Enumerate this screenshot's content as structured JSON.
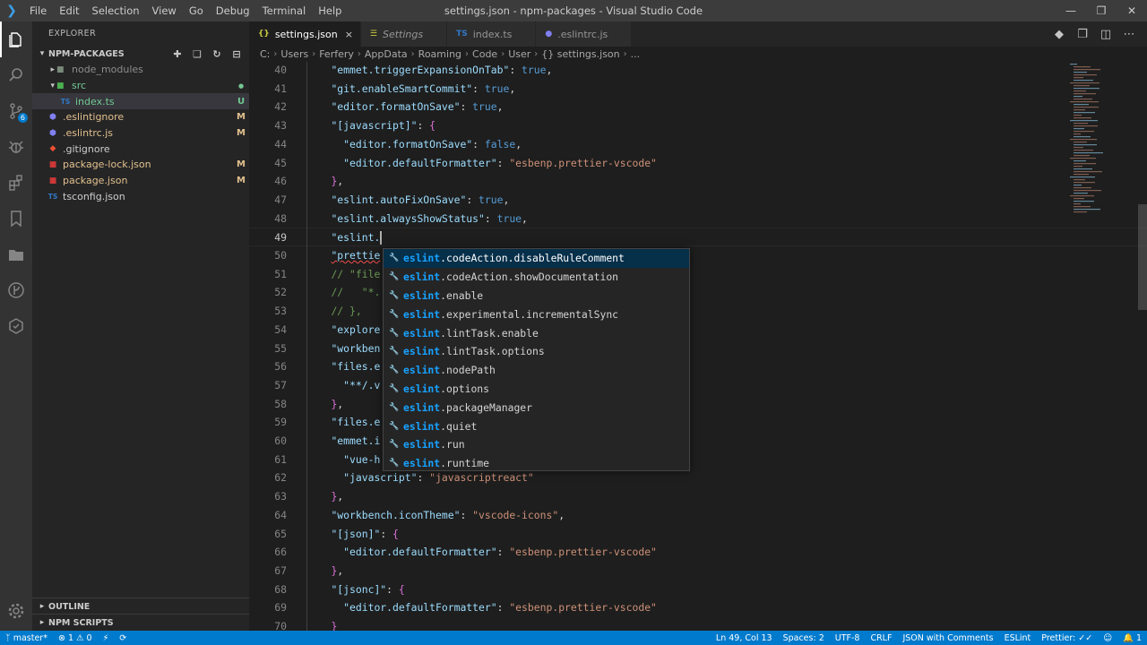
{
  "window": {
    "title": "settings.json - npm-packages - Visual Studio Code",
    "menu": [
      "File",
      "Edit",
      "Selection",
      "View",
      "Go",
      "Debug",
      "Terminal",
      "Help"
    ]
  },
  "activity": {
    "scm_badge": "6"
  },
  "sidebar": {
    "header": "EXPLORER",
    "project": "NPM-PACKAGES",
    "tree": [
      {
        "label": "node_modules",
        "indent": 1,
        "kind": "folder-collapsed",
        "status": "",
        "color": "gray"
      },
      {
        "label": "src",
        "indent": 1,
        "kind": "folder-open",
        "status": "",
        "color": "green"
      },
      {
        "label": "index.ts",
        "indent": 2,
        "kind": "ts",
        "status": "U",
        "color": "green"
      },
      {
        "label": ".eslintignore",
        "indent": 1,
        "kind": "eslint",
        "status": "M",
        "color": "yellow"
      },
      {
        "label": ".eslintrc.js",
        "indent": 1,
        "kind": "eslint",
        "status": "M",
        "color": "yellow"
      },
      {
        "label": ".gitignore",
        "indent": 1,
        "kind": "git",
        "status": "",
        "color": "plain"
      },
      {
        "label": "package-lock.json",
        "indent": 1,
        "kind": "npm",
        "status": "M",
        "color": "yellow"
      },
      {
        "label": "package.json",
        "indent": 1,
        "kind": "npm",
        "status": "M",
        "color": "yellow"
      },
      {
        "label": "tsconfig.json",
        "indent": 1,
        "kind": "ts",
        "status": "",
        "color": "plain"
      }
    ],
    "outline": "OUTLINE",
    "npm_scripts": "NPM SCRIPTS"
  },
  "tabs": [
    {
      "label": "settings.json",
      "icon": "{}",
      "active": true,
      "italic": false,
      "close": "×"
    },
    {
      "label": "Settings",
      "icon": "☰",
      "active": false,
      "italic": true,
      "close": ""
    },
    {
      "label": "index.ts",
      "icon": "TS",
      "active": false,
      "italic": false,
      "close": ""
    },
    {
      "label": ".eslintrc.js",
      "icon": "●",
      "active": false,
      "italic": false,
      "close": ""
    }
  ],
  "breadcrumb": [
    "C:",
    "Users",
    "Ferfery",
    "AppData",
    "Roaming",
    "Code",
    "User",
    "{} settings.json",
    "..."
  ],
  "editor": {
    "first_line": 40,
    "current_line": 49,
    "lines": [
      [
        [
          "    ",
          "p"
        ],
        [
          "\"emmet.triggerExpansionOnTab\"",
          "k"
        ],
        [
          ": ",
          "p"
        ],
        [
          "true",
          "b"
        ],
        [
          ",",
          "p"
        ]
      ],
      [
        [
          "    ",
          "p"
        ],
        [
          "\"git.enableSmartCommit\"",
          "k"
        ],
        [
          ": ",
          "p"
        ],
        [
          "true",
          "b"
        ],
        [
          ",",
          "p"
        ]
      ],
      [
        [
          "    ",
          "p"
        ],
        [
          "\"editor.formatOnSave\"",
          "k"
        ],
        [
          ": ",
          "p"
        ],
        [
          "true",
          "b"
        ],
        [
          ",",
          "p"
        ]
      ],
      [
        [
          "    ",
          "p"
        ],
        [
          "\"[javascript]\"",
          "k"
        ],
        [
          ": ",
          "p"
        ],
        [
          "{",
          "br"
        ]
      ],
      [
        [
          "      ",
          "p"
        ],
        [
          "\"editor.formatOnSave\"",
          "k2"
        ],
        [
          ": ",
          "p"
        ],
        [
          "false",
          "b"
        ],
        [
          ",",
          "p"
        ]
      ],
      [
        [
          "      ",
          "p"
        ],
        [
          "\"editor.defaultFormatter\"",
          "k2"
        ],
        [
          ": ",
          "p"
        ],
        [
          "\"esbenp.prettier-vscode\"",
          "s"
        ]
      ],
      [
        [
          "    ",
          "p"
        ],
        [
          "}",
          "br"
        ],
        [
          ",",
          "p"
        ]
      ],
      [
        [
          "    ",
          "p"
        ],
        [
          "\"eslint.autoFixOnSave\"",
          "k"
        ],
        [
          ": ",
          "p"
        ],
        [
          "true",
          "b"
        ],
        [
          ",",
          "p"
        ]
      ],
      [
        [
          "    ",
          "p"
        ],
        [
          "\"eslint.alwaysShowStatus\"",
          "k"
        ],
        [
          ": ",
          "p"
        ],
        [
          "true",
          "b"
        ],
        [
          ",",
          "p"
        ]
      ],
      [
        [
          "    ",
          "p"
        ],
        [
          "\"eslint.",
          "k"
        ],
        [
          "",
          "caret"
        ]
      ],
      [
        [
          "    ",
          "p"
        ],
        [
          "\"prettie",
          "kq"
        ]
      ],
      [
        [
          "    ",
          "p"
        ],
        [
          "// \"file",
          "c"
        ]
      ],
      [
        [
          "    ",
          "p"
        ],
        [
          "//   \"*.",
          "c"
        ]
      ],
      [
        [
          "    ",
          "p"
        ],
        [
          "// },",
          "c"
        ]
      ],
      [
        [
          "    ",
          "p"
        ],
        [
          "\"explore",
          "k"
        ]
      ],
      [
        [
          "    ",
          "p"
        ],
        [
          "\"workben",
          "k"
        ]
      ],
      [
        [
          "    ",
          "p"
        ],
        [
          "\"files.e",
          "k"
        ]
      ],
      [
        [
          "      ",
          "p"
        ],
        [
          "\"**/.v",
          "k2"
        ]
      ],
      [
        [
          "    ",
          "p"
        ],
        [
          "}",
          "br"
        ],
        [
          ",",
          "p"
        ]
      ],
      [
        [
          "    ",
          "p"
        ],
        [
          "\"files.e",
          "k"
        ]
      ],
      [
        [
          "    ",
          "p"
        ],
        [
          "\"emmet.i",
          "k"
        ]
      ],
      [
        [
          "      ",
          "p"
        ],
        [
          "\"vue-h",
          "k2"
        ]
      ],
      [
        [
          "      ",
          "p"
        ],
        [
          "\"javascript\"",
          "k2"
        ],
        [
          ": ",
          "p"
        ],
        [
          "\"javascriptreact\"",
          "s"
        ]
      ],
      [
        [
          "    ",
          "p"
        ],
        [
          "}",
          "br"
        ],
        [
          ",",
          "p"
        ]
      ],
      [
        [
          "    ",
          "p"
        ],
        [
          "\"workbench.iconTheme\"",
          "k"
        ],
        [
          ": ",
          "p"
        ],
        [
          "\"vscode-icons\"",
          "s"
        ],
        [
          ",",
          "p"
        ]
      ],
      [
        [
          "    ",
          "p"
        ],
        [
          "\"[json]\"",
          "k"
        ],
        [
          ": ",
          "p"
        ],
        [
          "{",
          "br"
        ]
      ],
      [
        [
          "      ",
          "p"
        ],
        [
          "\"editor.defaultFormatter\"",
          "k2"
        ],
        [
          ": ",
          "p"
        ],
        [
          "\"esbenp.prettier-vscode\"",
          "s"
        ]
      ],
      [
        [
          "    ",
          "p"
        ],
        [
          "}",
          "br"
        ],
        [
          ",",
          "p"
        ]
      ],
      [
        [
          "    ",
          "p"
        ],
        [
          "\"[jsonc]\"",
          "k"
        ],
        [
          ": ",
          "p"
        ],
        [
          "{",
          "br"
        ]
      ],
      [
        [
          "      ",
          "p"
        ],
        [
          "\"editor.defaultFormatter\"",
          "k2"
        ],
        [
          ": ",
          "p"
        ],
        [
          "\"esbenp.prettier-vscode\"",
          "s"
        ]
      ],
      [
        [
          "    ",
          "p"
        ],
        [
          "}",
          "br"
        ]
      ]
    ]
  },
  "suggest": {
    "prefix": "eslint",
    "items": [
      ".codeAction.disableRuleComment",
      ".codeAction.showDocumentation",
      ".enable",
      ".experimental.incrementalSync",
      ".lintTask.enable",
      ".lintTask.options",
      ".nodePath",
      ".options",
      ".packageManager",
      ".quiet",
      ".run",
      ".runtime"
    ]
  },
  "status": {
    "branch": "master*",
    "errors": "1",
    "warnings": "0",
    "position": "Ln 49, Col 13",
    "spaces": "Spaces: 2",
    "encoding": "UTF-8",
    "eol": "CRLF",
    "language": "JSON with Comments",
    "linter": "ESLint",
    "formatter": "Prettier: ✓✓",
    "notifications": "1"
  },
  "colors": {
    "accent": "#007acc",
    "suggest_highlight": "#18a3ff"
  }
}
